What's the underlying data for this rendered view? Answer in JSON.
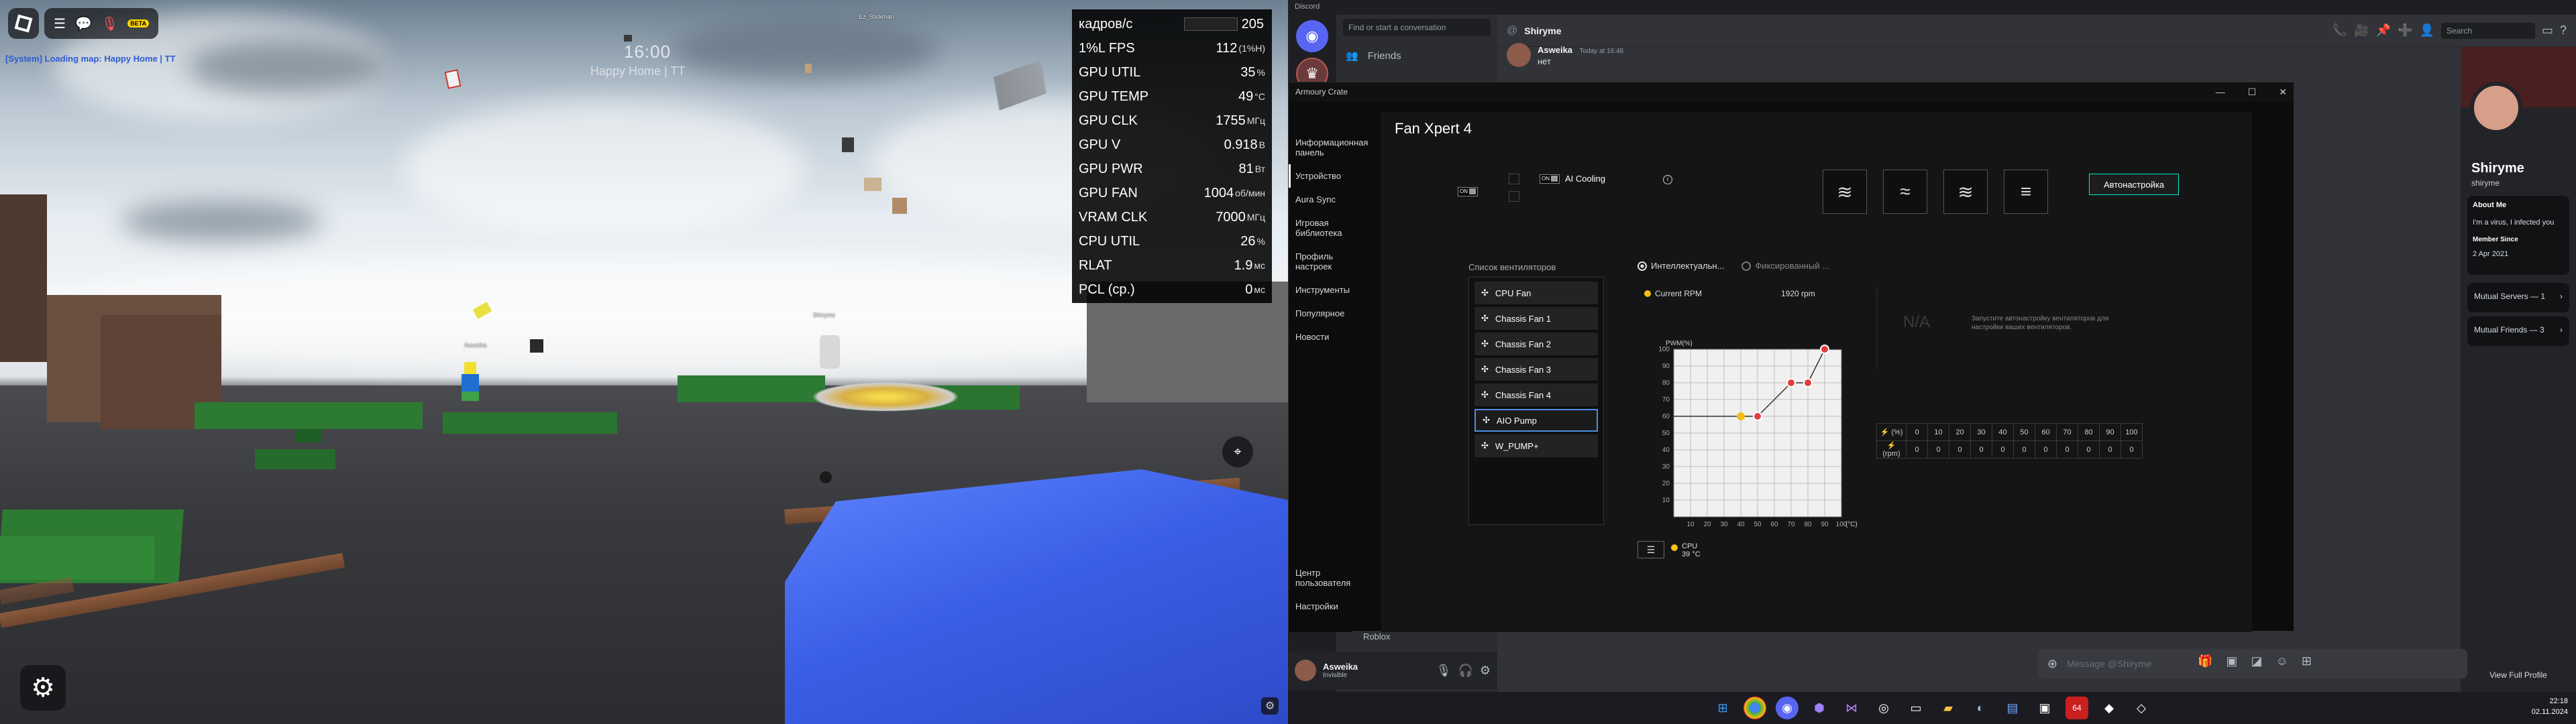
{
  "game": {
    "system_message": "[System] Loading map: Happy Home | TT",
    "beta_badge": "BETA",
    "time_display": "16:00",
    "subtitle": "Happy Home | TT",
    "player_tags": [
      "Ez_Stickman",
      "Shiryme",
      "Asweika"
    ]
  },
  "osd": {
    "rows": [
      {
        "label": "кадров/с",
        "value": "205",
        "unit": ""
      },
      {
        "label": "1%L FPS",
        "value": "112",
        "unit": "(1%H)"
      },
      {
        "label": "GPU UTIL",
        "value": "35",
        "unit": "%"
      },
      {
        "label": "GPU TEMP",
        "value": "49",
        "unit": "°C"
      },
      {
        "label": "GPU CLK",
        "value": "1755",
        "unit": "МГц"
      },
      {
        "label": "GPU V",
        "value": "0.918",
        "unit": "В"
      },
      {
        "label": "GPU PWR",
        "value": "81",
        "unit": "Вт"
      },
      {
        "label": "GPU FAN",
        "value": "1004",
        "unit": "об/мин"
      },
      {
        "label": "VRAM CLK",
        "value": "7000",
        "unit": "МГц"
      },
      {
        "label": "CPU UTIL",
        "value": "26",
        "unit": "%"
      },
      {
        "label": "RLAT",
        "value": "1.9",
        "unit": "мс"
      },
      {
        "label": "PCL (ср.)",
        "value": "0",
        "unit": "мс"
      }
    ]
  },
  "discord": {
    "app_title": "Discord",
    "search_placeholder": "Find or start a conversation",
    "friends_label": "Friends",
    "channel_name": "Shiryme",
    "message": {
      "author": "Asweika",
      "time": "Today at 16:48",
      "text": "нет"
    },
    "header_search": "Search",
    "message_placeholder": "Message @Shiryme",
    "roblox_activity": "Roblox",
    "user": {
      "name": "Asweika",
      "status": "Invisible"
    },
    "profile": {
      "display_name": "Shiryme",
      "username": "shiryme",
      "about_title": "About Me",
      "about_text": "I'm a virus, I infected you",
      "member_since_title": "Member Since",
      "member_since": "2 Apr 2021",
      "mutual_servers": "Mutual Servers — 1",
      "mutual_friends": "Mutual Friends — 3",
      "view_full": "View Full Profile"
    }
  },
  "armoury": {
    "window_title": "Armoury Crate",
    "nav": [
      "Информационная панель",
      "Устройство",
      "Aura Sync",
      "Игровая библиотека",
      "Профиль настроек",
      "Инструменты",
      "Популярное",
      "Новости"
    ],
    "nav_bottom": [
      "Центр пользователя",
      "Настройки"
    ],
    "heading": "Fan Xpert 4",
    "toggle_on": "ON",
    "ai_cooling_label": "AI Cooling",
    "autotune_label": "Автонастройка",
    "fanlist_title": "Список вентиляторов",
    "fans": [
      "CPU Fan",
      "Chassis Fan 1",
      "Chassis Fan 2",
      "Chassis Fan 3",
      "Chassis Fan 4",
      "AIO Pump",
      "W_PUMP+"
    ],
    "selected_fan": "AIO Pump",
    "mode_smart": "Интеллектуальн...",
    "mode_fixed": "Фиксированный ...",
    "current_rpm_label": "Current RPM",
    "current_rpm_value": "1920 rpm",
    "na_label": "N/A",
    "autotune_hint": "Запустите автонастройку вентиляторов для настройки ваших вентиляторов.",
    "table_header_label": "(%)",
    "table_rpm_label": "(rpm)",
    "table_columns": [
      "0",
      "10",
      "20",
      "30",
      "40",
      "50",
      "60",
      "70",
      "80",
      "90",
      "100"
    ],
    "table_rpm_values": [
      "0",
      "0",
      "0",
      "0",
      "0",
      "0",
      "0",
      "0",
      "0",
      "0",
      "0"
    ],
    "sensor_label": "CPU",
    "sensor_temp": "39 °C"
  },
  "chart_data": {
    "type": "line",
    "title": "",
    "ylabel": "PWM(%)",
    "xlabel": "(°C)",
    "xlim": [
      0,
      100
    ],
    "ylim": [
      0,
      100
    ],
    "x_ticks": [
      10,
      20,
      30,
      40,
      50,
      60,
      70,
      80,
      90,
      100
    ],
    "y_ticks": [
      10,
      20,
      30,
      40,
      50,
      60,
      70,
      80,
      90,
      100
    ],
    "series": [
      {
        "values": [
          [
            0,
            60
          ],
          [
            40,
            60
          ],
          [
            50,
            60
          ],
          [
            70,
            80
          ],
          [
            80,
            80
          ],
          [
            90,
            100
          ],
          [
            100,
            100
          ]
        ]
      }
    ],
    "points": [
      [
        50,
        60
      ],
      [
        70,
        80
      ],
      [
        80,
        80
      ],
      [
        90,
        100
      ]
    ],
    "current_point": [
      40,
      60
    ]
  },
  "taskbar": {
    "time": "22:18",
    "date": "02.11.2024"
  },
  "colors": {
    "osd_bg": "#000000",
    "accent_cyan": "#00cccc",
    "discord_blurple": "#5865f2",
    "curve_red": "#e23d3d",
    "current_yellow": "#f2c014"
  }
}
